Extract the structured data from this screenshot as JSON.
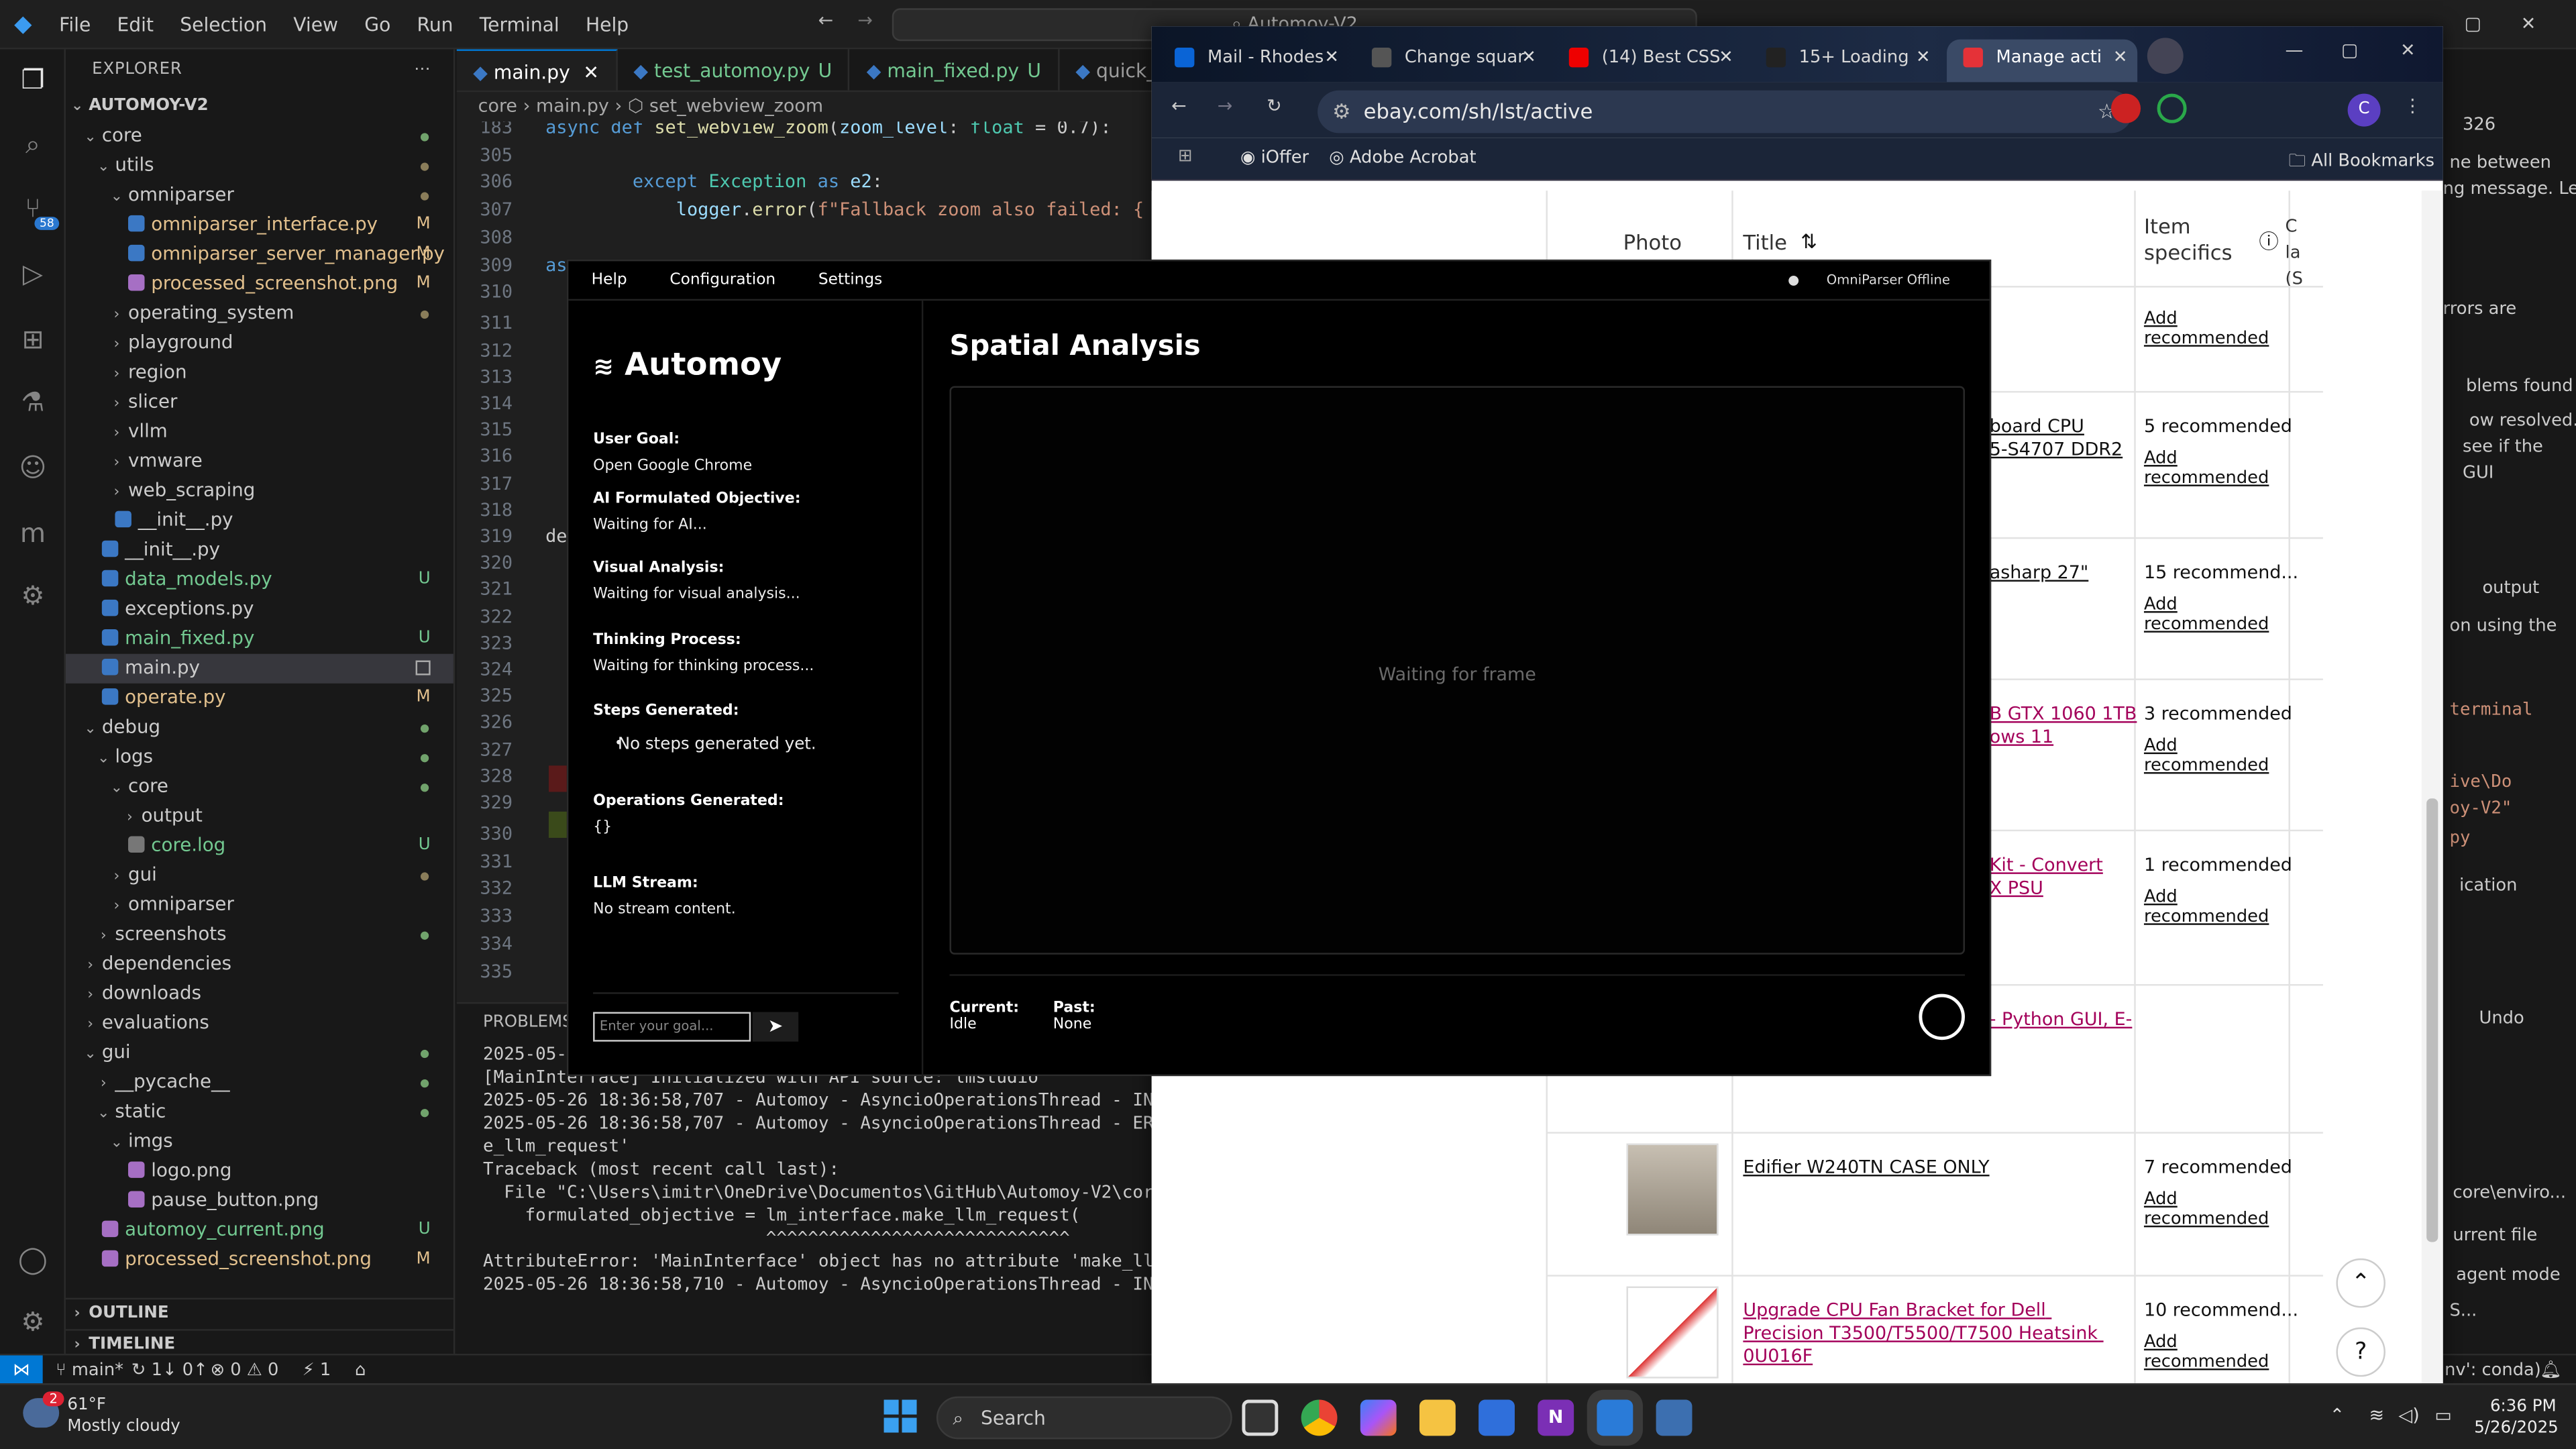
{
  "vscode": {
    "menu": [
      "File",
      "Edit",
      "Selection",
      "View",
      "Go",
      "Run",
      "Terminal",
      "Help"
    ],
    "command_center": "Automoy-V2",
    "explorer_title": "EXPLORER",
    "root_folder": "AUTOMOY-V2",
    "tree": [
      {
        "label": "core",
        "indent": 1,
        "arrow": "⌄",
        "git": "dot-g"
      },
      {
        "label": "utils",
        "indent": 2,
        "arrow": "⌄",
        "git": "dot"
      },
      {
        "label": "omniparser",
        "indent": 3,
        "arrow": "⌄",
        "git": "dot"
      },
      {
        "label": "omniparser_interface.py",
        "indent": 4,
        "py": true,
        "git": "M"
      },
      {
        "label": "omniparser_server_manager.py",
        "indent": 4,
        "py": true,
        "git": "M"
      },
      {
        "label": "processed_screenshot.png",
        "indent": 4,
        "img": true,
        "git": "M"
      },
      {
        "label": "operating_system",
        "indent": 3,
        "arrow": "›",
        "git": "dot"
      },
      {
        "label": "playground",
        "indent": 3,
        "arrow": "›"
      },
      {
        "label": "region",
        "indent": 3,
        "arrow": "›"
      },
      {
        "label": "slicer",
        "indent": 3,
        "arrow": "›"
      },
      {
        "label": "vllm",
        "indent": 3,
        "arrow": "›"
      },
      {
        "label": "vmware",
        "indent": 3,
        "arrow": "›"
      },
      {
        "label": "web_scraping",
        "indent": 3,
        "arrow": "›"
      },
      {
        "label": "__init__.py",
        "indent": 3,
        "py": true
      },
      {
        "label": "__init__.py",
        "indent": 2,
        "py": true
      },
      {
        "label": "data_models.py",
        "indent": 2,
        "py": true,
        "git": "U"
      },
      {
        "label": "exceptions.py",
        "indent": 2,
        "py": true
      },
      {
        "label": "main_fixed.py",
        "indent": 2,
        "py": true,
        "git": "U"
      },
      {
        "label": "main.py",
        "indent": 2,
        "py": true,
        "git": "box",
        "sel": true
      },
      {
        "label": "operate.py",
        "indent": 2,
        "py": true,
        "git": "M"
      },
      {
        "label": "debug",
        "indent": 1,
        "arrow": "⌄",
        "git": "dot-g"
      },
      {
        "label": "logs",
        "indent": 2,
        "arrow": "⌄",
        "git": "dot-g"
      },
      {
        "label": "core",
        "indent": 3,
        "arrow": "⌄",
        "git": "dot-g"
      },
      {
        "label": "output",
        "indent": 4,
        "arrow": "›"
      },
      {
        "label": "core.log",
        "indent": 4,
        "log": true,
        "git": "U"
      },
      {
        "label": "gui",
        "indent": 3,
        "arrow": "›",
        "git": "dot"
      },
      {
        "label": "omniparser",
        "indent": 3,
        "arrow": "›"
      },
      {
        "label": "screenshots",
        "indent": 2,
        "arrow": "›",
        "git": "dot-g"
      },
      {
        "label": "dependencies",
        "indent": 1,
        "arrow": "›"
      },
      {
        "label": "downloads",
        "indent": 1,
        "arrow": "›"
      },
      {
        "label": "evaluations",
        "indent": 1,
        "arrow": "›"
      },
      {
        "label": "gui",
        "indent": 1,
        "arrow": "⌄",
        "git": "dot-g"
      },
      {
        "label": "__pycache__",
        "indent": 2,
        "arrow": "›",
        "git": "dot-g"
      },
      {
        "label": "static",
        "indent": 2,
        "arrow": "⌄",
        "git": "dot-g"
      },
      {
        "label": "imgs",
        "indent": 3,
        "arrow": "⌄"
      },
      {
        "label": "logo.png",
        "indent": 4,
        "img": true
      },
      {
        "label": "pause_button.png",
        "indent": 4,
        "img": true
      },
      {
        "label": "automoy_current.png",
        "indent": 2,
        "img": true,
        "git": "U"
      },
      {
        "label": "processed_screenshot.png",
        "indent": 2,
        "img": true,
        "git": "M"
      }
    ],
    "outline": "OUTLINE",
    "timeline": "TIMELINE",
    "tabs": [
      {
        "label": "main.py",
        "active": true
      },
      {
        "label": "test_automoy.py",
        "git": "U"
      },
      {
        "label": "main_fixed.py",
        "git": "U"
      },
      {
        "label": "quick_"
      }
    ],
    "breadcrumb": [
      "core",
      "main.py",
      "set_webview_zoom"
    ],
    "code": [
      {
        "n": "183",
        "t": "async def set_webview_zoom(zoom_level: float = 0.7):"
      },
      {
        "n": "305",
        "t": ""
      },
      {
        "n": "306",
        "t": "        except Exception as e2:"
      },
      {
        "n": "307",
        "t": "            logger.error(f\"Fallback zoom also failed: {"
      },
      {
        "n": "308",
        "t": ""
      },
      {
        "n": "309",
        "t": "as"
      },
      {
        "n": "310",
        "t": ""
      },
      {
        "n": "311",
        "t": ""
      },
      {
        "n": "312",
        "t": ""
      },
      {
        "n": "313",
        "t": ""
      },
      {
        "n": "314",
        "t": ""
      },
      {
        "n": "315",
        "t": ""
      },
      {
        "n": "316",
        "t": ""
      },
      {
        "n": "317",
        "t": ""
      },
      {
        "n": "318",
        "t": ""
      },
      {
        "n": "319",
        "t": "de"
      },
      {
        "n": "320",
        "t": ""
      },
      {
        "n": "321",
        "t": ""
      },
      {
        "n": "322",
        "t": ""
      },
      {
        "n": "323",
        "t": ""
      },
      {
        "n": "324",
        "t": ""
      },
      {
        "n": "325",
        "t": ""
      },
      {
        "n": "326",
        "t": ""
      },
      {
        "n": "327",
        "t": ""
      },
      {
        "n": "328",
        "t": ""
      },
      {
        "n": "329",
        "t": ""
      },
      {
        "n": "330",
        "t": ""
      },
      {
        "n": "331",
        "t": ""
      },
      {
        "n": "332",
        "t": ""
      },
      {
        "n": "333",
        "t": ""
      },
      {
        "n": "334",
        "t": ""
      },
      {
        "n": "335",
        "t": ""
      }
    ],
    "panel_title": "PROBLEMS",
    "terminal": [
      "2025-05-26 18:36:58,705 - Automoy - AsyncioOperationsThread - INFO",
      "[MainInterface] Initialized with API source: lmstudio",
      "2025-05-26 18:36:58,707 - Automoy - AsyncioOperationsThread - INFO",
      "2025-05-26 18:36:58,707 - Automoy - AsyncioOperationsThread - ERROR",
      "e_llm_request'",
      "Traceback (most recent call last):",
      "  File \"C:\\Users\\imitr\\OneDrive\\Documentos\\GitHub\\Automoy-V2\\core\\",
      "    formulated_objective = lm_interface.make_llm_request(",
      "                           ^^^^^^^^^^^^^^^^^^^^^^^^^^^^^",
      "AttributeError: 'MainInterface' object has no attribute 'make_llm_",
      "2025-05-26 18:36:58,710 - Automoy - AsyncioOperationsThread - INFO"
    ],
    "status": {
      "branch": "main*",
      "sync": "↻ 1↓ 0↑",
      "problems": "⊗ 0 ⚠ 0",
      "ports": "⚡ 1",
      "conda": "nv': conda)"
    },
    "right_snippets": [
      "326",
      "ne between",
      "ng message. Let",
      "rrors are",
      "blems found",
      "ow resolved.",
      "see if the",
      "GUI",
      "output",
      "on using the",
      "terminal",
      "ive\\Do",
      "oy-V2\"",
      "py",
      "ication",
      "Undo",
      "core\\enviro...",
      "urrent file",
      "agent mode",
      "S..."
    ]
  },
  "chrome": {
    "tabs": [
      {
        "label": "Mail - Rhodes",
        "color": "#0a64d6"
      },
      {
        "label": "Change squar",
        "color": "#555"
      },
      {
        "label": "(14) Best CSS",
        "color": "#e00"
      },
      {
        "label": "15+ Loading",
        "color": "#222"
      },
      {
        "label": "Manage acti",
        "color": "#e53238",
        "active": true
      }
    ],
    "url": "ebay.com/sh/lst/active",
    "bookmarks": [
      "iOffer",
      "Adobe Acrobat"
    ],
    "all_bookmarks": "All Bookmarks",
    "profile_initial": "C",
    "ebay": {
      "headers": [
        "Photo",
        "Title",
        "Item specifics",
        "C la (S"
      ],
      "rows": [
        {
          "title": "",
          "spec": "",
          "add": "Add recommended"
        },
        {
          "title": "board CPU\n5-S4707 DDR2",
          "spec": "5 recommended",
          "add": "Add recommended",
          "link": "dark"
        },
        {
          "title": "asharp 27\"",
          "spec": "15 recommend...",
          "add": "Add recommended",
          "link": "dark"
        },
        {
          "title": "B GTX 1060 1TB\nows 11",
          "spec": "3 recommended",
          "add": "Add recommended",
          "link": "pink"
        },
        {
          "title": "Kit - Convert\nX PSU",
          "spec": "1 recommended",
          "add": "Add recommended",
          "link": "pink"
        },
        {
          "title": "- Python GUI, E-",
          "spec": "",
          "add": "",
          "link": "pink"
        },
        {
          "title": "Edifier W240TN CASE ONLY",
          "spec": "7 recommended",
          "add": "Add recommended",
          "link": "dark"
        },
        {
          "title": "Upgrade CPU Fan Bracket for Dell Precision T3500/T5500/T7500 Heatsink 0U016F",
          "spec": "10 recommend...",
          "add": "Add recommended",
          "link": "pink"
        }
      ]
    }
  },
  "automoy": {
    "menu": [
      "Help",
      "Configuration",
      "Settings"
    ],
    "server_status": "OmniParser Offline",
    "brand": "Automoy",
    "sections": [
      {
        "h": "User Goal:",
        "v": "Open Google Chrome"
      },
      {
        "h": "AI Formulated Objective:",
        "v": "Waiting for AI..."
      },
      {
        "h": "Visual Analysis:",
        "v": "Waiting for visual analysis..."
      },
      {
        "h": "Thinking Process:",
        "v": "Waiting for thinking process..."
      },
      {
        "h": "Steps Generated:",
        "v": "No steps generated yet."
      },
      {
        "h": "Operations Generated:",
        "v": "{}"
      },
      {
        "h": "LLM Stream:",
        "v": "No stream content."
      }
    ],
    "goal_placeholder": "Enter your goal...",
    "send_icon": "➤",
    "title": "Spatial Analysis",
    "waiting": "Waiting for frame",
    "current_label": "Current:",
    "current_value": "Idle",
    "past_label": "Past:",
    "past_value": "None"
  },
  "taskbar": {
    "temp": "61°F",
    "weather": "Mostly cloudy",
    "weather_badge": "2",
    "search": "Search",
    "time": "6:36 PM",
    "date": "5/26/2025"
  }
}
